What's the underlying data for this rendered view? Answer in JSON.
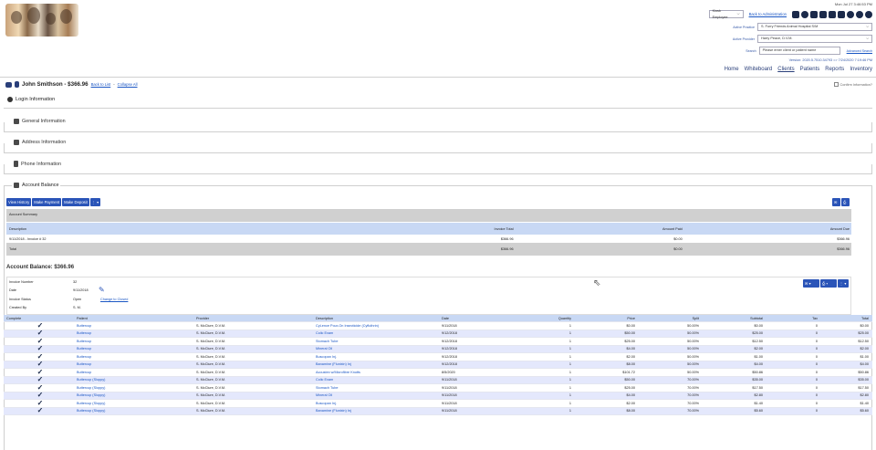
{
  "header": {
    "datetime": "Mon Jul 27 3:46:53 PM",
    "employee_select": "Kiosk Employee",
    "back_admin": "Back to Administration",
    "practice_label": "Active Practice",
    "practice_value": "S. Furry Friends Animal Hospital S/M",
    "provider_label": "Active Provider",
    "provider_value": "Harry Peace, D.V.M.",
    "search_label": "Search",
    "search_placeholder": "Please enter client or patient name",
    "advanced_search": "Advanced Search",
    "version": "Version: 2020.5.7510.34793 => 7/24/2020 7:19:46 PM"
  },
  "nav": [
    "Home",
    "Whiteboard",
    "Clients",
    "Patients",
    "Reports",
    "Inventory"
  ],
  "client": {
    "name": "John Smithson - $366.96",
    "back": "Back to List",
    "collapse": "Collapse All",
    "confirm": "Confirm Information?"
  },
  "sections": {
    "login": "Login Information",
    "general": "General Information",
    "address": "Address Information",
    "phone": "Phone Information",
    "account": "Account Balance"
  },
  "account_buttons": [
    "View History",
    "Make Payment",
    "Make Deposit"
  ],
  "summary": {
    "title": "Account Summary",
    "headers": [
      "Description",
      "Invoice Total",
      "Amount Paid",
      "Amount Due"
    ],
    "row": [
      "9/11/2018 - Invoice # 32",
      "$366.96",
      "$0.00",
      "$366.96"
    ],
    "total": [
      "Total",
      "$366.96",
      "$0.00",
      "$366.96"
    ]
  },
  "balance_title": "Account Balance: $366.96",
  "invoice": {
    "number_label": "Invoice Number",
    "number": "32",
    "date_label": "Date",
    "date": "9/11/2018",
    "status_label": "Invoice Status",
    "status": "Open",
    "change_link": "Change to Closed",
    "created_label": "Created By",
    "created": "S. M."
  },
  "lines": {
    "headers": [
      "Complete",
      "Patient",
      "Provider",
      "Description",
      "Date",
      "Quantity",
      "Price",
      "Split",
      "Subtotal",
      "Tax",
      "Total"
    ],
    "rows": [
      [
        "Buttercup",
        "S. McClure, D.V.M.",
        "CyLence Pour-On Insecticide (Cyfluthrin)",
        "9/11/2018",
        "1",
        "$0.00",
        "50.00%",
        "$0.00",
        "0",
        "$0.00"
      ],
      [
        "Buttercup",
        "S. McClure, D.V.M.",
        "Colic Exam",
        "9/12/2018",
        "1",
        "$50.00",
        "50.00%",
        "$25.00",
        "0",
        "$25.00"
      ],
      [
        "Buttercup",
        "S. McClure, D.V.M.",
        "Stomach Tube",
        "9/12/2018",
        "1",
        "$25.00",
        "50.00%",
        "$12.50",
        "0",
        "$12.50"
      ],
      [
        "Buttercup",
        "S. McClure, D.V.M.",
        "Mineral Oil",
        "9/12/2018",
        "1",
        "$4.00",
        "50.00%",
        "$2.00",
        "0",
        "$2.00"
      ],
      [
        "Buttercup",
        "S. McClure, D.V.M.",
        "Buscopan Inj.",
        "9/12/2018",
        "1",
        "$2.00",
        "50.00%",
        "$1.00",
        "0",
        "$1.00"
      ],
      [
        "Buttercup",
        "S. McClure, D.V.M.",
        "Banamine (Flunixin) Inj",
        "9/12/2018",
        "1",
        "$8.00",
        "50.00%",
        "$4.00",
        "0",
        "$4.00"
      ],
      [
        "Buttercup",
        "S. McClure, D.V.M.",
        "Acoustex w/Microfibre Knotts",
        "8/5/2020",
        "1",
        "$101.72",
        "50.00%",
        "$50.86",
        "0",
        "$50.86"
      ],
      [
        "Buttercup (Sloppy)",
        "S. McClure, D.V.M.",
        "Colic Exam",
        "9/11/2018",
        "1",
        "$50.00",
        "70.00%",
        "$35.00",
        "0",
        "$35.00"
      ],
      [
        "Buttercup (Sloppy)",
        "S. McClure, D.V.M.",
        "Stomach Tube",
        "9/11/2018",
        "1",
        "$25.00",
        "70.00%",
        "$17.50",
        "0",
        "$17.50"
      ],
      [
        "Buttercup (Sloppy)",
        "S. McClure, D.V.M.",
        "Mineral Oil",
        "9/11/2018",
        "1",
        "$4.00",
        "70.00%",
        "$2.80",
        "0",
        "$2.80"
      ],
      [
        "Buttercup (Sloppy)",
        "S. McClure, D.V.M.",
        "Buscopan Inj.",
        "9/11/2018",
        "1",
        "$2.00",
        "70.00%",
        "$1.40",
        "0",
        "$1.40"
      ],
      [
        "Buttercup (Sloppy)",
        "S. McClure, D.V.M.",
        "Banamine (Flunixin) Inj",
        "9/11/2018",
        "1",
        "$8.00",
        "70.00%",
        "$5.60",
        "0",
        "$5.60"
      ]
    ]
  }
}
